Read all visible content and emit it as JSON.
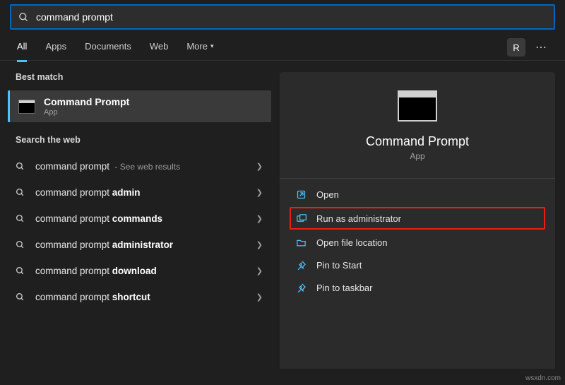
{
  "search": {
    "value": "command prompt"
  },
  "tabs": {
    "all": "All",
    "apps": "Apps",
    "documents": "Documents",
    "web": "Web",
    "more": "More"
  },
  "user_initial": "R",
  "left": {
    "best_match_label": "Best match",
    "best_match": {
      "title": "Command Prompt",
      "subtitle": "App"
    },
    "web_label": "Search the web",
    "web_items": [
      {
        "prefix": "command prompt",
        "bold": "",
        "hint": " - See web results"
      },
      {
        "prefix": "command prompt ",
        "bold": "admin",
        "hint": ""
      },
      {
        "prefix": "command prompt ",
        "bold": "commands",
        "hint": ""
      },
      {
        "prefix": "command prompt ",
        "bold": "administrator",
        "hint": ""
      },
      {
        "prefix": "command prompt ",
        "bold": "download",
        "hint": ""
      },
      {
        "prefix": "command prompt ",
        "bold": "shortcut",
        "hint": ""
      }
    ]
  },
  "right": {
    "title": "Command Prompt",
    "subtitle": "App",
    "actions": {
      "open": "Open",
      "admin": "Run as administrator",
      "location": "Open file location",
      "pin_start": "Pin to Start",
      "pin_taskbar": "Pin to taskbar"
    }
  },
  "watermark": "wsxdn.com"
}
